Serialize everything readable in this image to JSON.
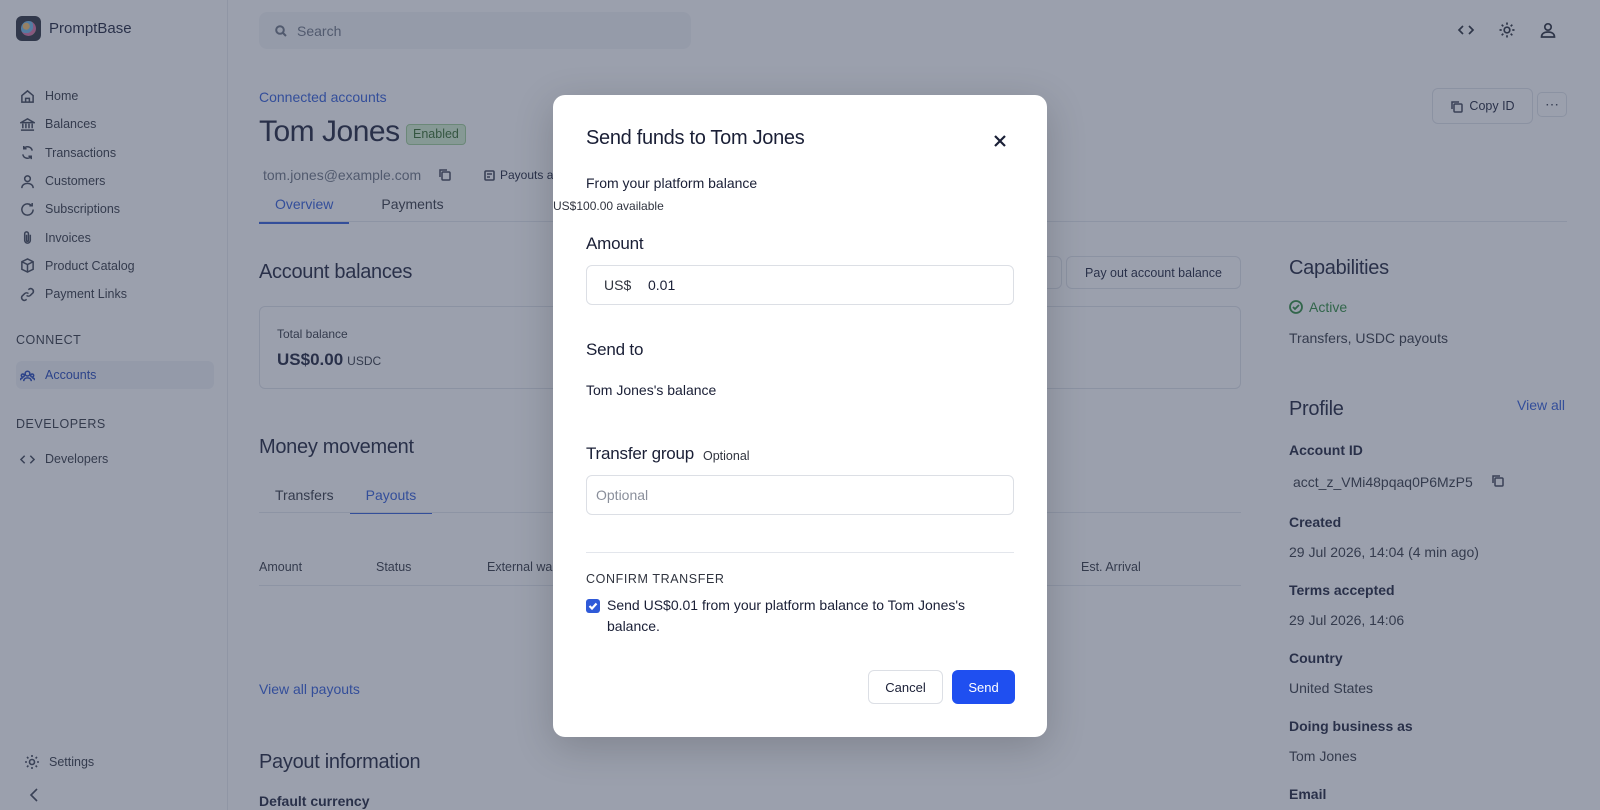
{
  "app": {
    "name": "PromptBase"
  },
  "sidebar": {
    "items": [
      {
        "label": "Home",
        "icon": "home-icon"
      },
      {
        "label": "Balances",
        "icon": "bank-icon"
      },
      {
        "label": "Transactions",
        "icon": "transactions-icon"
      },
      {
        "label": "Customers",
        "icon": "user-icon"
      },
      {
        "label": "Subscriptions",
        "icon": "refresh-icon"
      },
      {
        "label": "Invoices",
        "icon": "paperclip-icon"
      },
      {
        "label": "Product Catalog",
        "icon": "box-icon"
      },
      {
        "label": "Payment Links",
        "icon": "link-icon"
      }
    ],
    "connect_heading": "CONNECT",
    "connect_items": [
      {
        "label": "Accounts",
        "icon": "accounts-icon",
        "active": true
      }
    ],
    "developers_heading": "DEVELOPERS",
    "developers_items": [
      {
        "label": "Developers",
        "icon": "code-icon"
      }
    ],
    "settings_label": "Settings"
  },
  "topbar": {
    "search_placeholder": "Search"
  },
  "account": {
    "breadcrumb": "Connected accounts",
    "name": "Tom Jones",
    "status": "Enabled",
    "email": "tom.jones@example.com",
    "payouts_chip": "Payouts a",
    "copy_id_label": "Copy ID",
    "more_label": "⋯",
    "tabs": [
      "Overview",
      "Payments"
    ]
  },
  "balances": {
    "heading": "Account balances",
    "payout_button": "Pay out account balance",
    "total_label": "Total balance",
    "total_value": "US$0.00",
    "total_unit": "USDC"
  },
  "money_movement": {
    "heading": "Money movement",
    "tabs": [
      "Transfers",
      "Payouts"
    ],
    "columns": [
      "Amount",
      "Status",
      "External wa",
      "Est. Arrival"
    ],
    "view_all": "View all payouts"
  },
  "payout_info": {
    "heading": "Payout information",
    "default_currency": "Default currency"
  },
  "capabilities": {
    "heading": "Capabilities",
    "status": "Active",
    "list": "Transfers, USDC payouts"
  },
  "profile": {
    "heading": "Profile",
    "view_all": "View all",
    "account_id_label": "Account ID",
    "account_id": "acct_z_VMi48pqaq0P6MzP5",
    "created_label": "Created",
    "created": "29 Jul 2026, 14:04 (4 min ago)",
    "terms_label": "Terms accepted",
    "terms": "29 Jul 2026, 14:06",
    "country_label": "Country",
    "country": "United States",
    "dba_label": "Doing business as",
    "dba": "Tom Jones",
    "email_label": "Email"
  },
  "modal": {
    "title": "Send funds to Tom Jones",
    "from_label": "From your platform balance",
    "available": "US$100.00 available",
    "amount_label": "Amount",
    "amount_prefix": "US$",
    "amount_value": "0.01",
    "send_to_label": "Send to",
    "send_to_value": "Tom Jones's balance",
    "group_label": "Transfer group",
    "group_optional": "Optional",
    "group_placeholder": "Optional",
    "confirm_heading": "CONFIRM TRANSFER",
    "confirm_text": "Send US$0.01 from your platform balance to Tom Jones's balance.",
    "confirm_checked": true,
    "cancel_label": "Cancel",
    "send_label": "Send"
  },
  "colors": {
    "accent": "#1f4ff0",
    "link": "#2f5ad8",
    "success": "#2c8a3b",
    "overlay": "rgba(56,66,92,0.5)"
  }
}
